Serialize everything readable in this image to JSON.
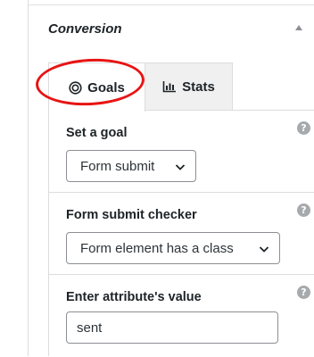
{
  "panel": {
    "title": "Conversion",
    "collapse_icon": "triangle-up-icon"
  },
  "tabs": [
    {
      "label": "Goals",
      "icon": "target-icon",
      "active": true,
      "highlighted": true
    },
    {
      "label": "Stats",
      "icon": "bar-chart-icon",
      "active": false
    }
  ],
  "fields": {
    "goal": {
      "label": "Set a goal",
      "selected": "Form submit",
      "help_icon": "question-icon"
    },
    "checker": {
      "label": "Form submit checker",
      "selected": "Form element has a class",
      "help_icon": "question-icon"
    },
    "value": {
      "label": "Enter attribute's value",
      "value": "sent",
      "help_icon": "question-icon"
    }
  },
  "colors": {
    "highlight": "#e81414",
    "border": "#dcdcde",
    "inactive_tab": "#f0f0f1",
    "help_icon": "#a7aaad"
  }
}
